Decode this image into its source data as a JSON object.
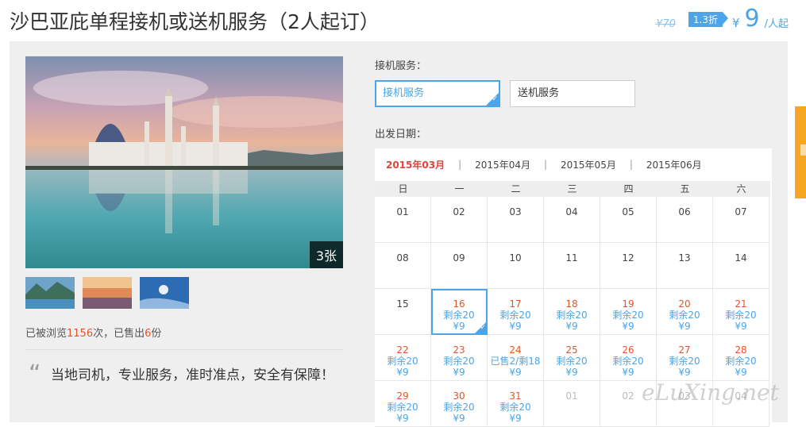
{
  "title": "沙巴亚庇单程接机或送机服务（2人起订）",
  "price": {
    "original": "¥70",
    "discount": "1.3折",
    "currency": "¥",
    "amount": "9",
    "unit": "/人起"
  },
  "gallery": {
    "count_label": "3张",
    "thumbnails": [
      "thumb-lake",
      "thumb-sunset",
      "thumb-diving"
    ]
  },
  "stats": {
    "prefix": "已被浏览",
    "views": "1156",
    "middle": "次，已售出",
    "sold": "6",
    "suffix": "份"
  },
  "quote": "当地司机，专业服务，准时准点，安全有保障！",
  "service": {
    "label": "接机服务：",
    "options": [
      "接机服务",
      "送机服务"
    ],
    "selected_index": 0
  },
  "date": {
    "label": "出发日期："
  },
  "calendar": {
    "months": [
      "2015年03月",
      "2015年04月",
      "2015年05月",
      "2015年06月"
    ],
    "active_month_index": 0,
    "weekdays": [
      "日",
      "一",
      "二",
      "三",
      "四",
      "五",
      "六"
    ],
    "rows": [
      [
        {
          "d": "01"
        },
        {
          "d": "02"
        },
        {
          "d": "03"
        },
        {
          "d": "04"
        },
        {
          "d": "05"
        },
        {
          "d": "06"
        },
        {
          "d": "07"
        }
      ],
      [
        {
          "d": "08"
        },
        {
          "d": "09"
        },
        {
          "d": "10"
        },
        {
          "d": "11"
        },
        {
          "d": "12"
        },
        {
          "d": "13"
        },
        {
          "d": "14"
        }
      ],
      [
        {
          "d": "15"
        },
        {
          "d": "16",
          "r": "剩余20",
          "p": "¥9",
          "sel": true
        },
        {
          "d": "17",
          "r": "剩余20",
          "p": "¥9"
        },
        {
          "d": "18",
          "r": "剩余20",
          "p": "¥9"
        },
        {
          "d": "19",
          "r": "剩余20",
          "p": "¥9"
        },
        {
          "d": "20",
          "r": "剩余20",
          "p": "¥9"
        },
        {
          "d": "21",
          "r": "剩余20",
          "p": "¥9"
        }
      ],
      [
        {
          "d": "22",
          "r": "剩余20",
          "p": "¥9"
        },
        {
          "d": "23",
          "r": "剩余20",
          "p": "¥9"
        },
        {
          "d": "24",
          "r": "已售2/剩18",
          "p": "¥9"
        },
        {
          "d": "25",
          "r": "剩余20",
          "p": "¥9"
        },
        {
          "d": "26",
          "r": "剩余20",
          "p": "¥9"
        },
        {
          "d": "27",
          "r": "剩余20",
          "p": "¥9"
        },
        {
          "d": "28",
          "r": "剩余20",
          "p": "¥9"
        }
      ],
      [
        {
          "d": "29",
          "r": "剩余20",
          "p": "¥9"
        },
        {
          "d": "30",
          "r": "剩余20",
          "p": "¥9"
        },
        {
          "d": "31",
          "r": "剩余20",
          "p": "¥9"
        },
        {
          "d": "01",
          "fade": true
        },
        {
          "d": "02",
          "fade": true
        },
        {
          "d": "03",
          "fade": true
        },
        {
          "d": "04",
          "fade": true
        }
      ]
    ]
  },
  "watermark": "eLuXing.net",
  "colors": {
    "accent": "#4ba5e8",
    "highlight": "#e4542a",
    "active_month": "#d9463b",
    "side_tab": "#f5a623"
  }
}
